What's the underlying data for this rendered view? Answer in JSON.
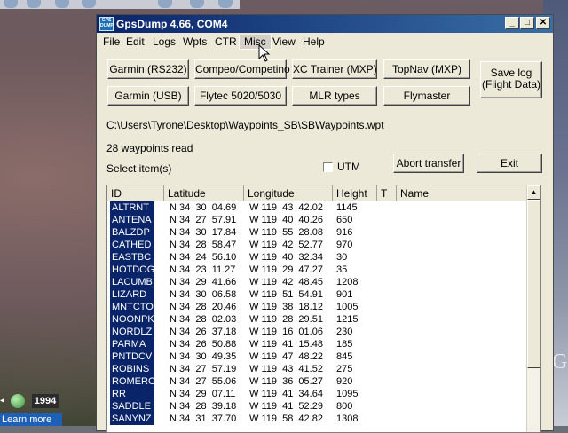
{
  "desktop": {
    "year_text": "1994",
    "learn_more": "Learn more",
    "corner_glyph": "G"
  },
  "window": {
    "title": "GpsDump 4.66, COM4",
    "icon_text": "GPS DUMP",
    "buttons": {
      "minimize": "_",
      "maximize": "□",
      "close": "✕"
    }
  },
  "menu": [
    {
      "label": "File"
    },
    {
      "label": "Edit"
    },
    {
      "label": "Logs"
    },
    {
      "label": "Wpts"
    },
    {
      "label": "CTR"
    },
    {
      "label": "Misc"
    },
    {
      "label": "View"
    },
    {
      "label": "Help"
    }
  ],
  "device_buttons": {
    "garmin_rs232": "Garmin (RS232)",
    "compeo": "Compeo/Competino",
    "xc_trainer": "XC Trainer (MXP)",
    "topnav": "TopNav (MXP)",
    "garmin_usb": "Garmin (USB)",
    "flytec": "Flytec 5020/5030",
    "mlr": "MLR types",
    "flymaster": "Flymaster",
    "save_log_line1": "Save log",
    "save_log_line2": "(Flight Data)"
  },
  "file_path": "C:\\Users\\Tyrone\\Desktop\\Waypoints_SB\\SBWaypoints.wpt",
  "status": "28 waypoints read",
  "select_label": "Select item(s)",
  "utm_label": "UTM",
  "abort_button": "Abort transfer",
  "exit_button": "Exit",
  "list": {
    "columns": [
      "ID",
      "Latitude",
      "Longitude",
      "Height",
      "T",
      "Name"
    ],
    "rows": [
      {
        "id": "ALTRNT",
        "lat": "N 34  30  04.69",
        "lon": "W 119  43  42.02",
        "height": "1145"
      },
      {
        "id": "ANTENA",
        "lat": "N 34  27  57.91",
        "lon": "W 119  40  40.26",
        "height": "650"
      },
      {
        "id": "BALZDP",
        "lat": "N 34  30  17.84",
        "lon": "W 119  55  28.08",
        "height": "916"
      },
      {
        "id": "CATHED",
        "lat": "N 34  28  58.47",
        "lon": "W 119  42  52.77",
        "height": "970"
      },
      {
        "id": "EASTBC",
        "lat": "N 34  24  56.10",
        "lon": "W 119  40  32.34",
        "height": "30"
      },
      {
        "id": "HOTDOG",
        "lat": "N 34  23  11.27",
        "lon": "W 119  29  47.27",
        "height": "35"
      },
      {
        "id": "LACUMB",
        "lat": "N 34  29  41.66",
        "lon": "W 119  42  48.45",
        "height": "1208"
      },
      {
        "id": "LIZARD",
        "lat": "N 34  30  06.58",
        "lon": "W 119  51  54.91",
        "height": "901"
      },
      {
        "id": "MNTCTO",
        "lat": "N 34  28  20.46",
        "lon": "W 119  38  18.12",
        "height": "1005"
      },
      {
        "id": "NOONPK",
        "lat": "N 34  28  02.03",
        "lon": "W 119  28  29.51",
        "height": "1215"
      },
      {
        "id": "NORDLZ",
        "lat": "N 34  26  37.18",
        "lon": "W 119  16  01.06",
        "height": "230"
      },
      {
        "id": "PARMA",
        "lat": "N 34  26  50.88",
        "lon": "W 119  41  15.48",
        "height": "185"
      },
      {
        "id": "PNTDCV",
        "lat": "N 34  30  49.35",
        "lon": "W 119  47  48.22",
        "height": "845"
      },
      {
        "id": "ROBINS",
        "lat": "N 34  27  57.19",
        "lon": "W 119  43  41.52",
        "height": "275"
      },
      {
        "id": "ROMERO",
        "lat": "N 34  27  55.06",
        "lon": "W 119  36  05.27",
        "height": "920"
      },
      {
        "id": "RR",
        "lat": "N 34  29  07.11",
        "lon": "W 119  41  34.64",
        "height": "1095"
      },
      {
        "id": "SADDLE",
        "lat": "N 34  28  39.18",
        "lon": "W 119  41  52.29",
        "height": "800"
      },
      {
        "id": "SANYNZ",
        "lat": "N 34  31  37.70",
        "lon": "W 119  58  42.82",
        "height": "1308"
      }
    ]
  }
}
